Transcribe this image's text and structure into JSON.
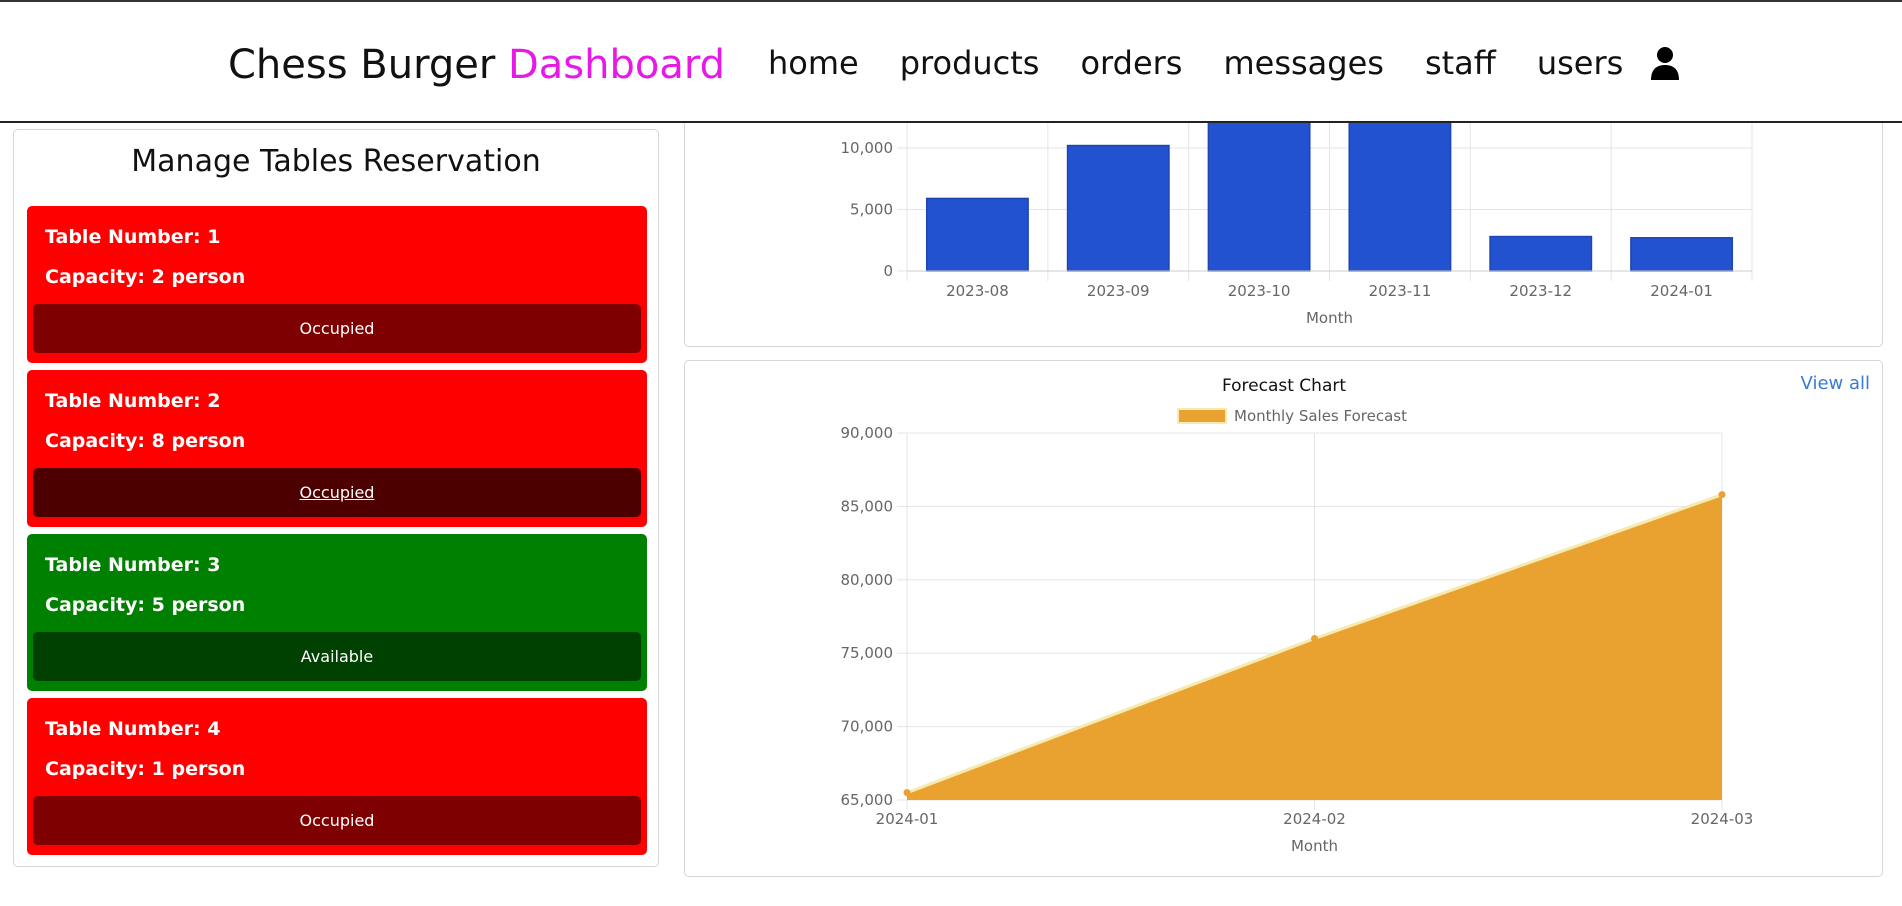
{
  "header": {
    "brand_main": "Chess Burger ",
    "brand_accent": "Dashboard",
    "nav": [
      "home",
      "products",
      "orders",
      "messages",
      "staff",
      "users"
    ],
    "user_icon": "user-icon"
  },
  "tables_panel": {
    "title": "Manage Tables Reservation",
    "tables": [
      {
        "number": "Table Number: 1",
        "capacity": "Capacity: 2 person",
        "status": "Occupied",
        "color": "#ff0000"
      },
      {
        "number": "Table Number: 2",
        "capacity": "Capacity: 8 person",
        "status": "Occupied",
        "color": "#ff0000"
      },
      {
        "number": "Table Number: 3",
        "capacity": "Capacity: 5 person",
        "status": "Available",
        "color": "#008000"
      },
      {
        "number": "Table Number: 4",
        "capacity": "Capacity: 1 person",
        "status": "Occupied",
        "color": "#ff0000"
      }
    ]
  },
  "forecast_panel": {
    "view_all": "View all"
  },
  "chart_data": [
    {
      "type": "bar",
      "categories": [
        "2023-08",
        "2023-09",
        "2023-10",
        "2023-11",
        "2023-12",
        "2024-01"
      ],
      "values": [
        5900,
        10200,
        13200,
        12900,
        2800,
        2700
      ],
      "xlabel": "Month",
      "ylabel": "",
      "ytick_labels": [
        "0",
        "5,000",
        "10,000"
      ],
      "yticks": [
        0,
        5000,
        10000
      ],
      "ylim": [
        0,
        10000
      ],
      "color": "#2352d0",
      "grid": true
    },
    {
      "type": "area",
      "title": "Forecast Chart",
      "categories": [
        "2024-01",
        "2024-02",
        "2024-03"
      ],
      "series": [
        {
          "name": "Monthly Sales Forecast",
          "values": [
            65500,
            76000,
            85800
          ]
        }
      ],
      "xlabel": "Month",
      "ylabel": "",
      "ytick_labels": [
        "65,000",
        "70,000",
        "75,000",
        "80,000",
        "85,000",
        "90,000"
      ],
      "yticks": [
        65000,
        70000,
        75000,
        80000,
        85000,
        90000
      ],
      "ylim": [
        65000,
        90000
      ],
      "color": "#e9a230",
      "line_color": "#f5ebb0",
      "legend": "top",
      "grid": true
    }
  ]
}
